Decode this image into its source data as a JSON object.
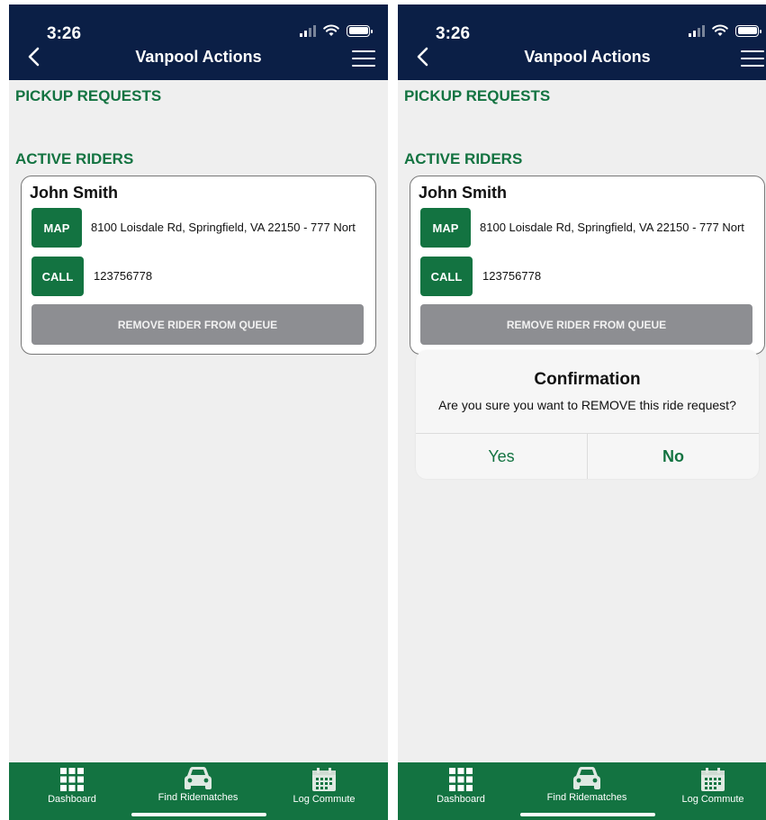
{
  "status_bar": {
    "time": "3:26"
  },
  "header": {
    "title": "Vanpool Actions"
  },
  "sections": {
    "pickup_requests": "PICKUP REQUESTS",
    "active_riders": "ACTIVE RIDERS"
  },
  "rider": {
    "name": "John Smith",
    "map_label": "MAP",
    "address": "8100 Loisdale Rd, Springfield, VA 22150 - 777 Nort",
    "call_label": "CALL",
    "phone": "123756778",
    "remove_label": "REMOVE RIDER FROM QUEUE"
  },
  "confirmation": {
    "title": "Confirmation",
    "message": "Are you sure you want to REMOVE this ride request?",
    "yes": "Yes",
    "no": "No"
  },
  "bottom_nav": {
    "items": [
      {
        "label": "Dashboard",
        "icon": "grid-icon"
      },
      {
        "label": "Find Ridematches",
        "icon": "car-icon"
      },
      {
        "label": "Log Commute",
        "icon": "calendar-icon"
      }
    ]
  },
  "colors": {
    "nav_bg": "#0b1f46",
    "brand_green": "#137341",
    "remove_gray": "#8d8e92",
    "page_bg": "#efefef"
  }
}
